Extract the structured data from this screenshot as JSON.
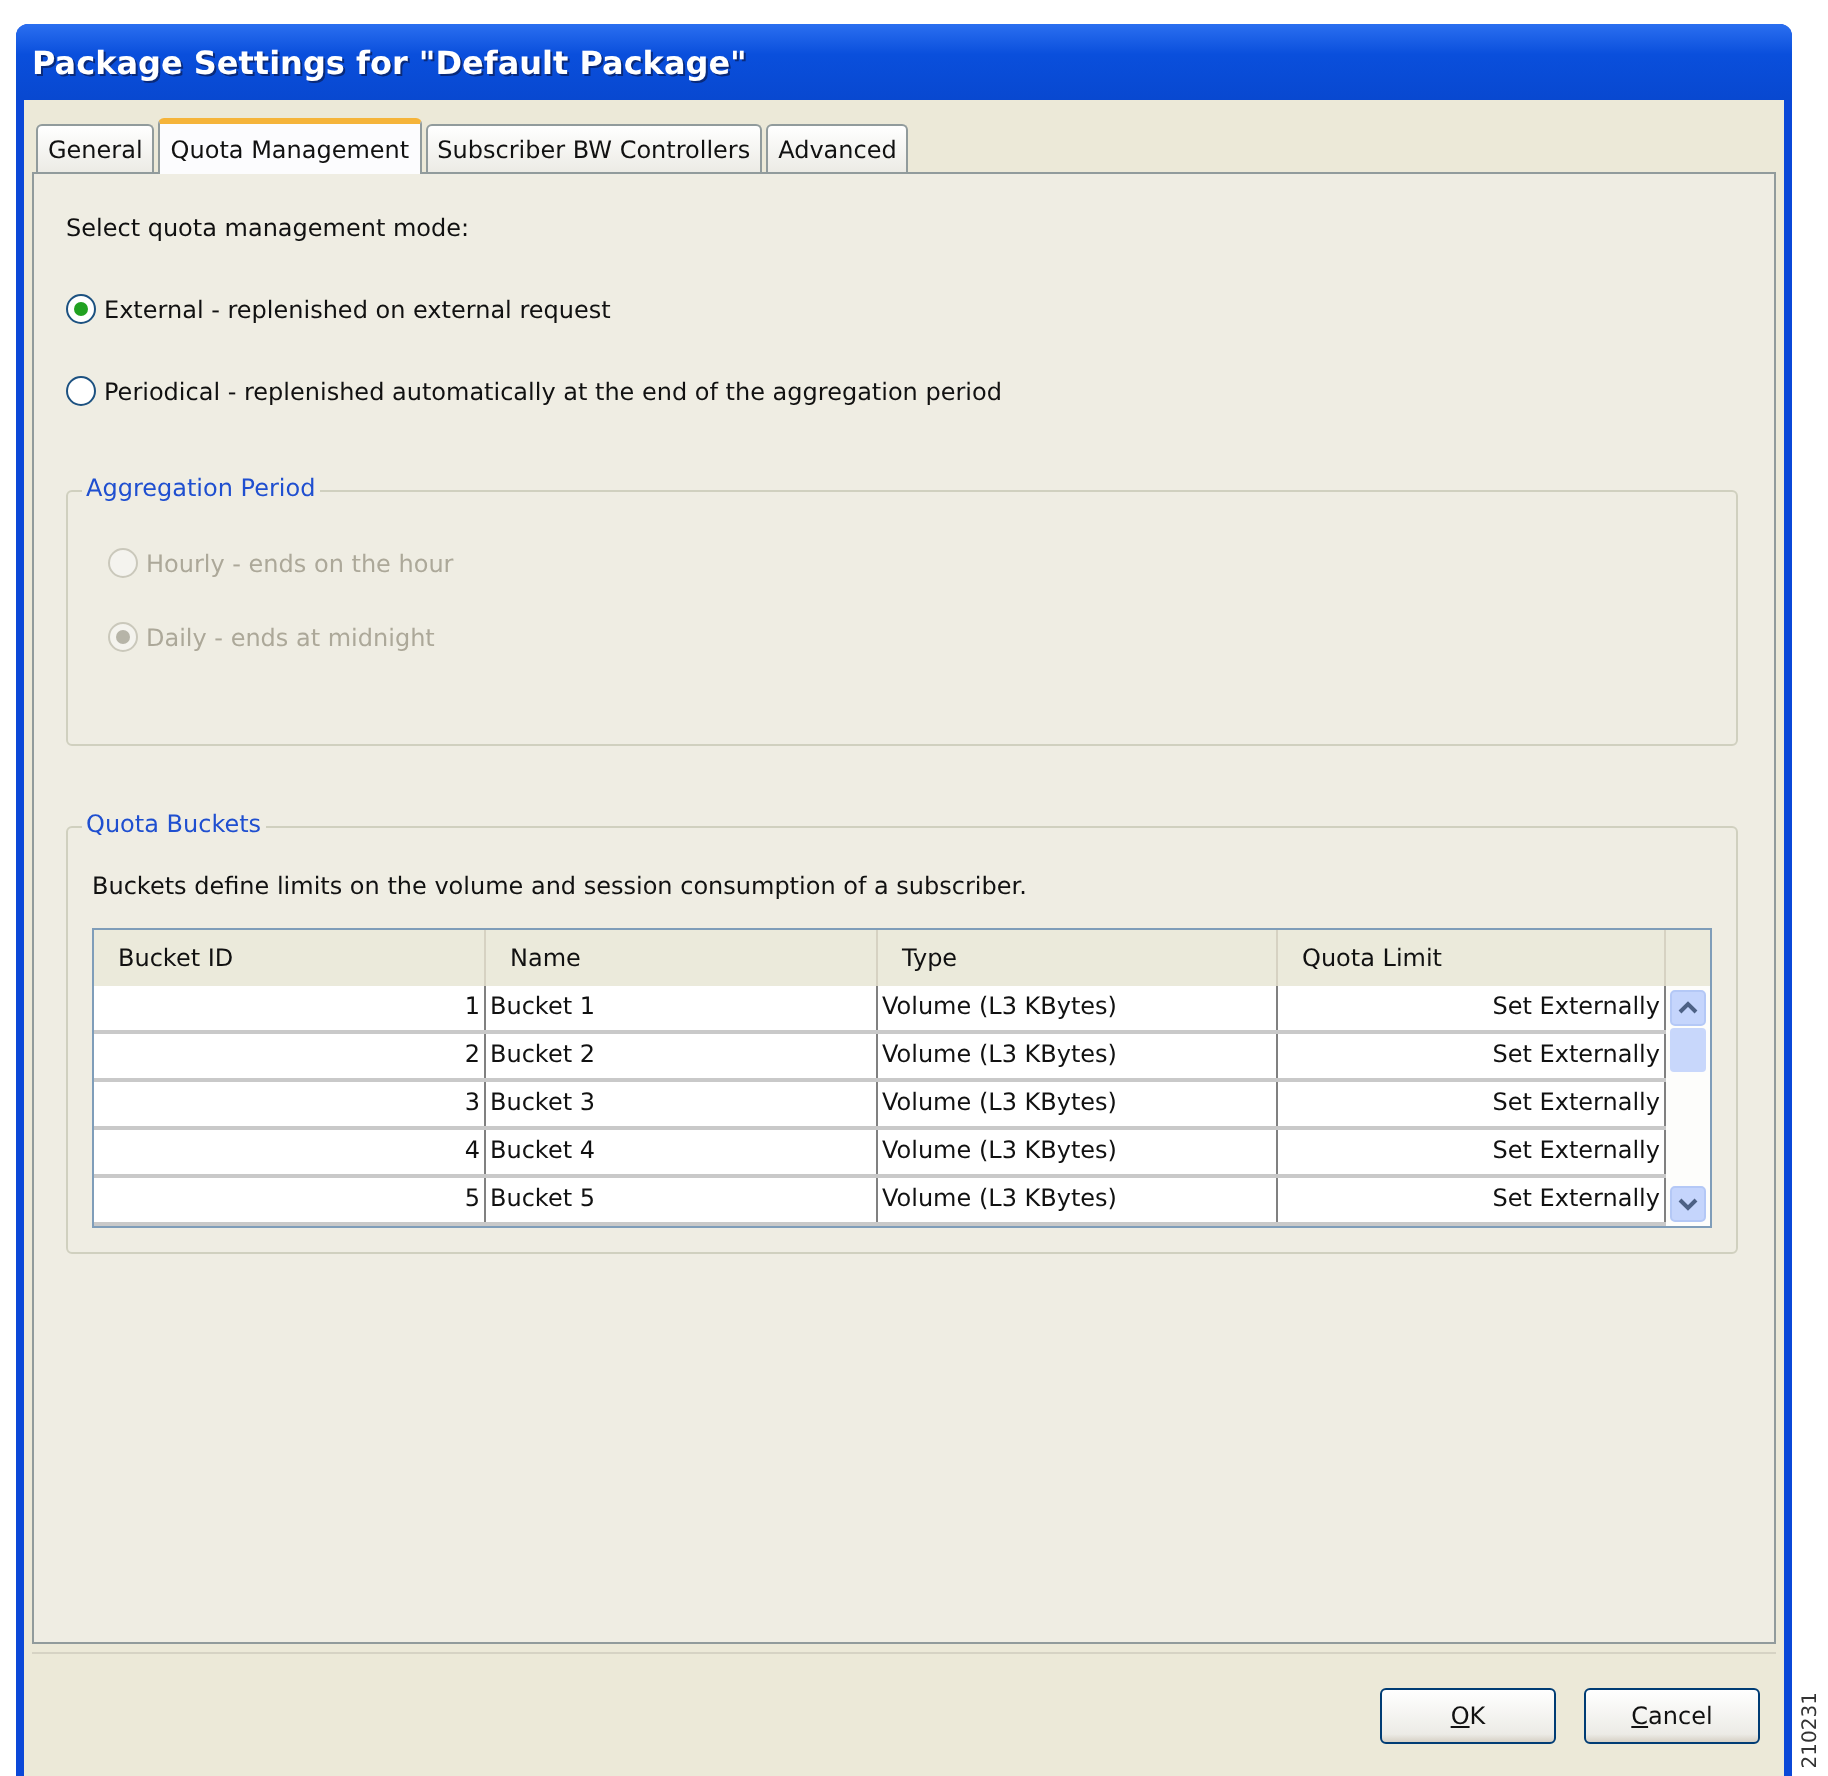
{
  "window": {
    "title": "Package Settings for \"Default Package\""
  },
  "tabs": [
    {
      "label": "General",
      "selected": false
    },
    {
      "label": "Quota Management",
      "selected": true
    },
    {
      "label": "Subscriber BW Controllers",
      "selected": false
    },
    {
      "label": "Advanced",
      "selected": false
    }
  ],
  "mode": {
    "prompt": "Select quota management mode:",
    "options": [
      {
        "label": "External - replenished on external request",
        "selected": true,
        "disabled": false
      },
      {
        "label": "Periodical - replenished automatically at the end of the aggregation period",
        "selected": false,
        "disabled": false
      }
    ]
  },
  "aggregation_period": {
    "title": "Aggregation Period",
    "options": [
      {
        "label": "Hourly - ends on the hour",
        "selected": false,
        "disabled": true
      },
      {
        "label": "Daily - ends at midnight",
        "selected": true,
        "disabled": true
      }
    ]
  },
  "quota_buckets": {
    "title": "Quota Buckets",
    "description": "Buckets define limits on the volume and session consumption of a subscriber.",
    "table": {
      "columns": [
        "Bucket ID",
        "Name",
        "Type",
        "Quota Limit"
      ],
      "rows": [
        [
          "1",
          "Bucket 1",
          "Volume (L3 KBytes)",
          "Set Externally"
        ],
        [
          "2",
          "Bucket 2",
          "Volume (L3 KBytes)",
          "Set Externally"
        ],
        [
          "3",
          "Bucket 3",
          "Volume (L3 KBytes)",
          "Set Externally"
        ],
        [
          "4",
          "Bucket 4",
          "Volume (L3 KBytes)",
          "Set Externally"
        ],
        [
          "5",
          "Bucket 5",
          "Volume (L3 KBytes)",
          "Set Externally"
        ]
      ]
    }
  },
  "buttons": [
    "OK",
    "Cancel"
  ],
  "figure_number": "210231"
}
